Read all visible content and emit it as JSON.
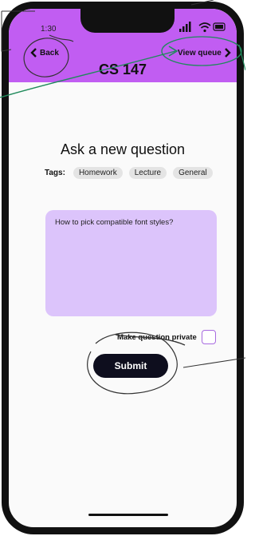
{
  "status_bar": {
    "time": "1:30",
    "icons": [
      "signal-icon",
      "wifi-icon",
      "battery-icon"
    ]
  },
  "header": {
    "back_label": "Back",
    "view_queue_label": "View queue",
    "course_title": "CS 147",
    "background_color": "#c15df2"
  },
  "main": {
    "page_title": "Ask a new question",
    "tags_label": "Tags:",
    "tags": [
      "Homework",
      "Lecture",
      "General"
    ],
    "question_text": "How to pick compatible font styles?",
    "private_label": "Make question private",
    "private_checked": false,
    "submit_label": "Submit"
  },
  "colors": {
    "accent": "#c15df2",
    "question_box": "#dcc4fb",
    "button": "#0e0e1e",
    "annotation_green": "#1f8a5b"
  }
}
